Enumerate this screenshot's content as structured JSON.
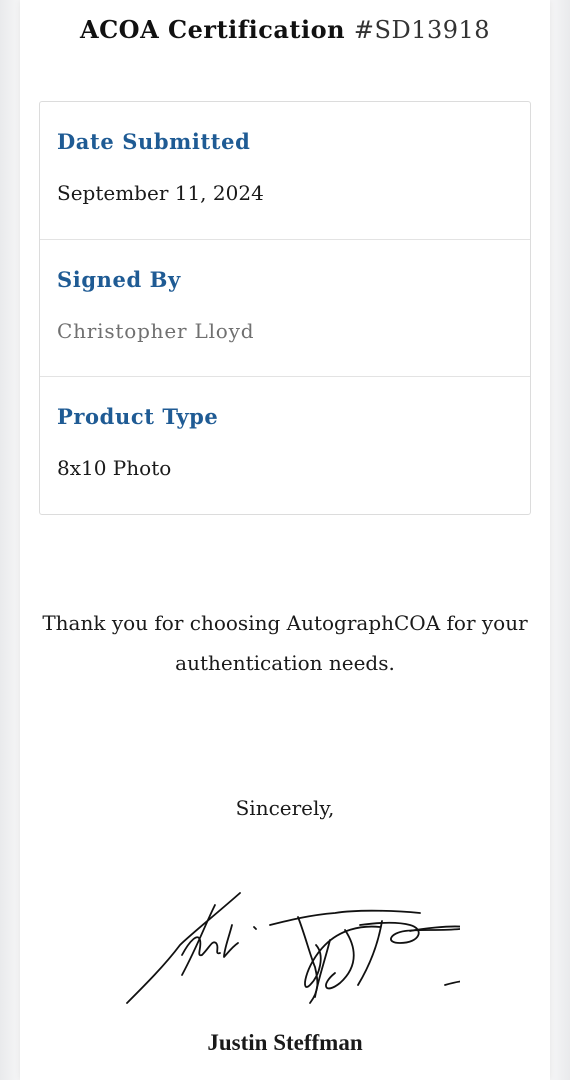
{
  "certificate": {
    "title_prefix": "ACOA Certification",
    "number": "#SD13918"
  },
  "details": [
    {
      "label": "Date Submitted",
      "value": "September 11, 2024"
    },
    {
      "label": "Signed By",
      "value": "Christopher Lloyd"
    },
    {
      "label": "Product Type",
      "value": "8x10 Photo"
    }
  ],
  "closing": {
    "thanks": "Thank you for choosing AutographCOA for your authentication needs.",
    "sincerely": "Sincerely,",
    "signer_name": "Justin Steffman"
  },
  "colors": {
    "label_blue": "#1f5b94",
    "muted_value": "#707070"
  }
}
